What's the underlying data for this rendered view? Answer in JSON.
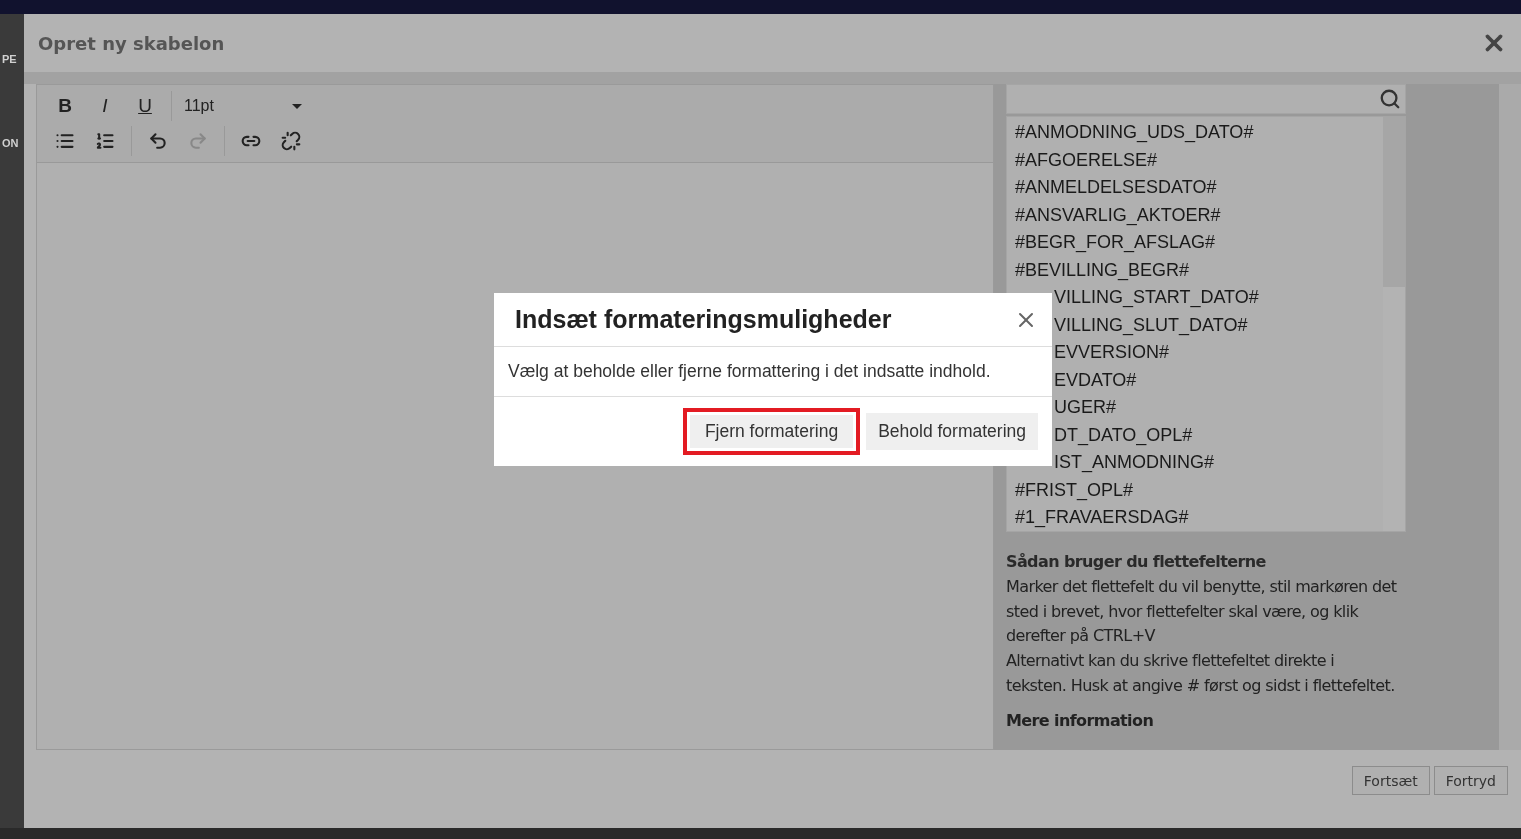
{
  "background_fragments": [
    "PE",
    "ON"
  ],
  "window": {
    "title": "Opret ny skabelon"
  },
  "toolbar": {
    "format_buttons": [
      {
        "label": "B",
        "kind": "bold"
      },
      {
        "label": "I",
        "kind": "italic"
      },
      {
        "label": "U",
        "kind": "underline"
      }
    ],
    "font_size": "11pt",
    "tools": [
      {
        "kind": "bullet-list",
        "disabled": false
      },
      {
        "kind": "numbered-list",
        "disabled": false
      },
      {
        "kind": "undo",
        "disabled": false
      },
      {
        "kind": "redo",
        "disabled": true
      },
      {
        "kind": "link",
        "disabled": false
      },
      {
        "kind": "unlink",
        "disabled": false
      }
    ]
  },
  "merge_fields": [
    {
      "text": "#ANMODNING_UDS_DATO#",
      "kind": "full"
    },
    {
      "text": "#AFGOERELSE#",
      "kind": "full"
    },
    {
      "text": "#ANMELDELSESDATO#",
      "kind": "full"
    },
    {
      "text": "#ANSVARLIG_AKTOER#",
      "kind": "full"
    },
    {
      "text": "#BEGR_FOR_AFSLAG#",
      "kind": "full"
    },
    {
      "text": "#BEVILLING_BEGR#",
      "kind": "full"
    },
    {
      "text": "VILLING_START_DATO#",
      "kind": "partial"
    },
    {
      "text": "VILLING_SLUT_DATO#",
      "kind": "partial"
    },
    {
      "text": "EVVERSION#",
      "kind": "partial"
    },
    {
      "text": "EVDATO#",
      "kind": "partial"
    },
    {
      "text": "UGER#",
      "kind": "partial"
    },
    {
      "text": "DT_DATO_OPL#",
      "kind": "partial"
    },
    {
      "text": "IST_ANMODNING#",
      "kind": "partial"
    },
    {
      "text": "#FRIST_OPL#",
      "kind": "full"
    },
    {
      "text": "#1_FRAVAERSDAG#",
      "kind": "full"
    }
  ],
  "help": {
    "title": "Sådan bruger du flettefelterne",
    "paragraphs": [
      "Marker det flettefelt du vil benytte, stil markøren det sted i brevet, hvor flettefelter skal være, og klik derefter på CTRL+V",
      "Alternativt kan du skrive flettefeltet direkte i teksten. Husk at angive # først og sidst i flettefeltet."
    ],
    "more_title": "Mere information"
  },
  "footer_buttons": [
    "Fortsæt",
    "Fortryd"
  ],
  "paste_dialog": {
    "title": "Indsæt formateringsmuligheder",
    "message": "Vælg at beholde eller fjerne formattering i det indsatte indhold.",
    "buttons": [
      {
        "label": "Fjern formatering",
        "highlighted": true
      },
      {
        "label": "Behold formatering",
        "highlighted": false
      }
    ]
  }
}
